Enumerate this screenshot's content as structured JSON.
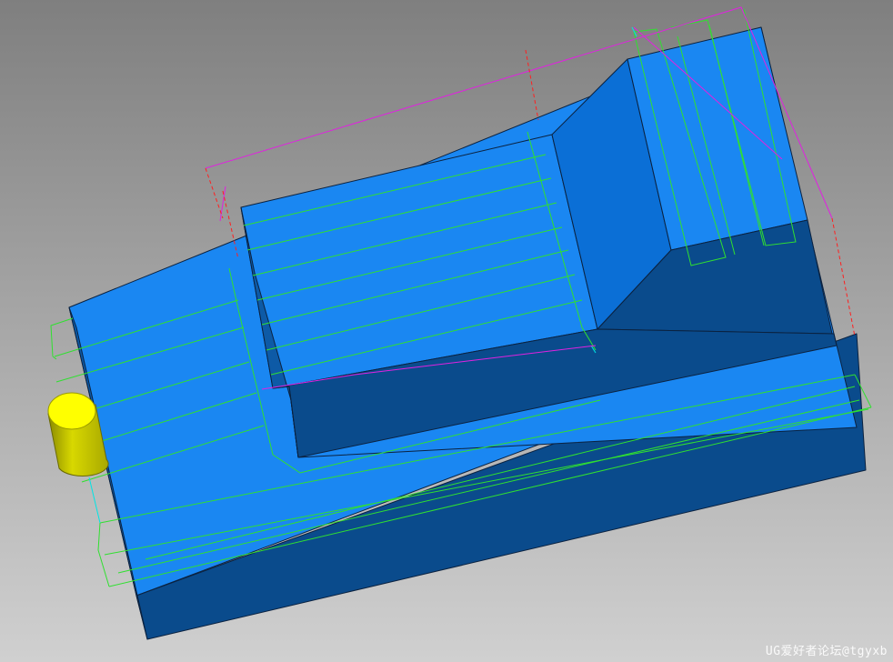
{
  "viewport": {
    "background_top": "#7e7e7e",
    "background_bottom": "#cfcfcf",
    "colors": {
      "face_light": "#1a87f2",
      "face_mid": "#0b6fd6",
      "face_dark": "#0a4b8c",
      "edge": "#0b2240",
      "toolpath_cut": "#30e030",
      "toolpath_engage": "#00e5e5",
      "toolpath_rapid": "#e022e0",
      "toolpath_plunge": "#ff2020",
      "tool": "#f2f200"
    },
    "objects": {
      "part": "machined-part",
      "tool": "cylindrical-tool",
      "toolpath": "cutter-path"
    }
  },
  "watermark": "UG爱好者论坛@tgyxb"
}
